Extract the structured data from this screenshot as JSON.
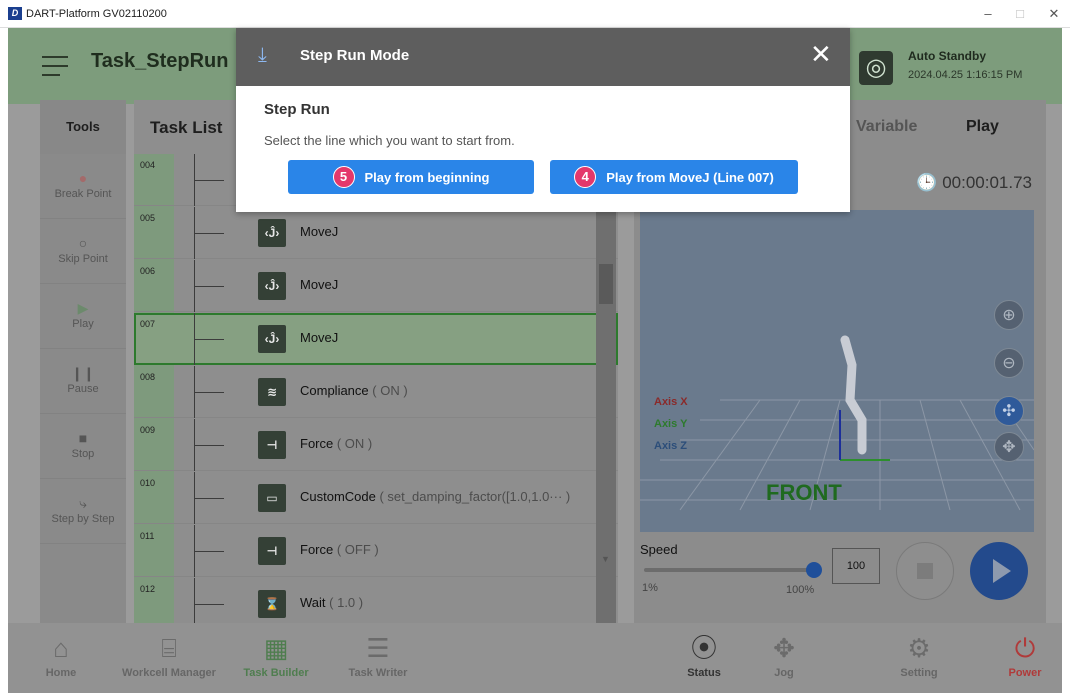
{
  "window": {
    "title": "DART-Platform GV02110200",
    "logo": "D",
    "minimize_icon": "–",
    "maximize_icon": "□",
    "close_icon": "✕"
  },
  "header": {
    "task_name": "Task_StepRun",
    "status_title": "Auto Standby",
    "status_time": "2024.04.25 1:16:15 PM"
  },
  "tools": {
    "title": "Tools",
    "items": [
      {
        "label": "Break Point",
        "icon": "break-point-icon"
      },
      {
        "label": "Skip Point",
        "icon": "skip-point-icon"
      },
      {
        "label": "Play",
        "icon": "play-icon"
      },
      {
        "label": "Pause",
        "icon": "pause-icon"
      },
      {
        "label": "Stop",
        "icon": "stop-icon"
      },
      {
        "label": "Step by Step",
        "icon": "step-icon"
      }
    ]
  },
  "task_list": {
    "title": "Task List",
    "rows": [
      {
        "num": "004",
        "name": "",
        "arg": "",
        "icon": ""
      },
      {
        "num": "005",
        "name": "MoveJ",
        "arg": "",
        "icon": "‹Ĵ›"
      },
      {
        "num": "006",
        "name": "MoveJ",
        "arg": "",
        "icon": "‹Ĵ›"
      },
      {
        "num": "007",
        "name": "MoveJ",
        "arg": "",
        "icon": "‹Ĵ›"
      },
      {
        "num": "008",
        "name": "Compliance",
        "arg": " ( ON )",
        "icon": "≋"
      },
      {
        "num": "009",
        "name": "Force",
        "arg": " ( ON )",
        "icon": "⊣"
      },
      {
        "num": "010",
        "name": "CustomCode",
        "arg": " ( set_damping_factor([1.0,1.0··· )",
        "icon": "▭"
      },
      {
        "num": "011",
        "name": "Force",
        "arg": " ( OFF )",
        "icon": "⊣"
      },
      {
        "num": "012",
        "name": "Wait",
        "arg": " ( 1.0 )",
        "icon": "⌛"
      }
    ]
  },
  "right_panel": {
    "tabs": [
      "Variable",
      "Play"
    ],
    "active_tab": "Play",
    "timer": "00:00:01.73",
    "axis_x": "Axis X",
    "axis_y": "Axis Y",
    "axis_z": "Axis Z",
    "view_label": "FRONT",
    "speed_label": "Speed",
    "speed_min": "1%",
    "speed_max": "100%",
    "speed_value": "100",
    "speed_fraction": 1.0
  },
  "bottom_nav": [
    {
      "label": "Home",
      "icon": "⌂"
    },
    {
      "label": "Workcell Manager",
      "icon": "⌸"
    },
    {
      "label": "Task Builder",
      "icon": "▦"
    },
    {
      "label": "Task Writer",
      "icon": "☰"
    },
    {
      "label": "Status",
      "icon": "⦿"
    },
    {
      "label": "Jog",
      "icon": "✥"
    },
    {
      "label": "Setting",
      "icon": "⚙"
    },
    {
      "label": "Power",
      "icon": "⏻"
    }
  ],
  "modal": {
    "title": "Step Run Mode",
    "subtitle": "Step Run",
    "description": "Select the line which you want to start from.",
    "btn1_badge": "5",
    "btn1_label": "Play from beginning",
    "btn2_badge": "4",
    "btn2_label": "Play from MoveJ (Line 007)"
  },
  "colors": {
    "accent": "#2a85e8",
    "badge": "#e4386b",
    "power": "#c0392b",
    "task_builder": "#4f7d4f"
  }
}
